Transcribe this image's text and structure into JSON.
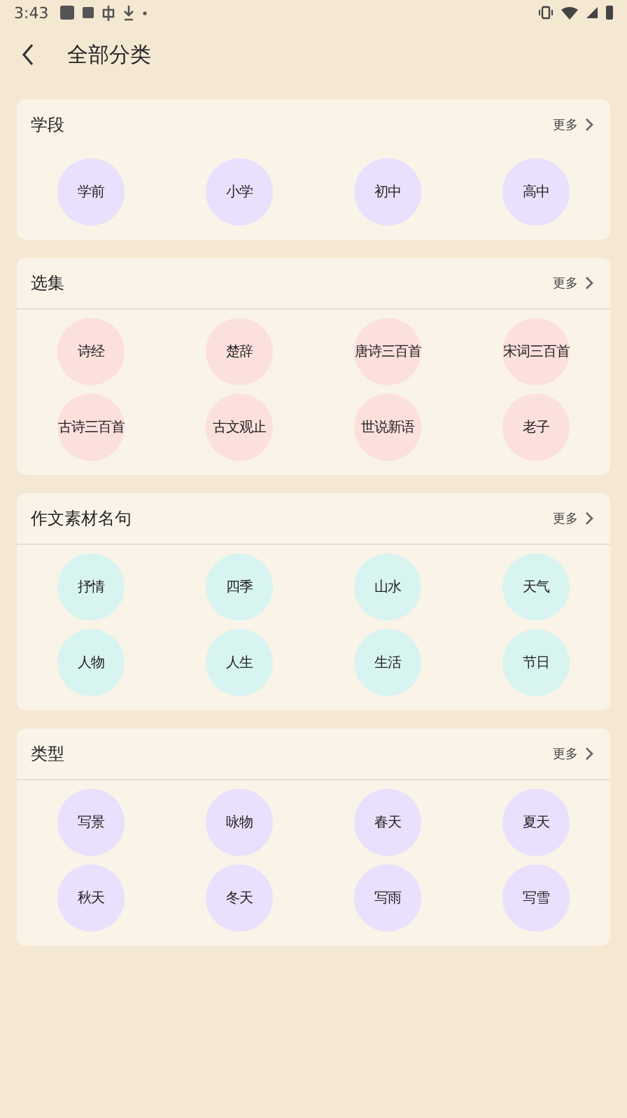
{
  "status_bar": {
    "time": "3:43"
  },
  "header": {
    "title": "全部分类"
  },
  "sections": [
    {
      "title": "学段",
      "more": "更多",
      "divider": false,
      "color": "#e8e0fc",
      "items": [
        "学前",
        "小学",
        "初中",
        "高中"
      ]
    },
    {
      "title": "选集",
      "more": "更多",
      "divider": true,
      "color": "#fce0dc",
      "items": [
        "诗经",
        "楚辞",
        "唐诗三百首",
        "宋词三百首",
        "古诗三百首",
        "古文观止",
        "世说新语",
        "老子"
      ]
    },
    {
      "title": "作文素材名句",
      "more": "更多",
      "divider": true,
      "color": "#d8f4f0",
      "items": [
        "抒情",
        "四季",
        "山水",
        "天气",
        "人物",
        "人生",
        "生活",
        "节日"
      ]
    },
    {
      "title": "类型",
      "more": "更多",
      "divider": true,
      "color": "#e8e0fc",
      "items": [
        "写景",
        "咏物",
        "春天",
        "夏天",
        "秋天",
        "冬天",
        "写雨",
        "写雪"
      ]
    }
  ]
}
